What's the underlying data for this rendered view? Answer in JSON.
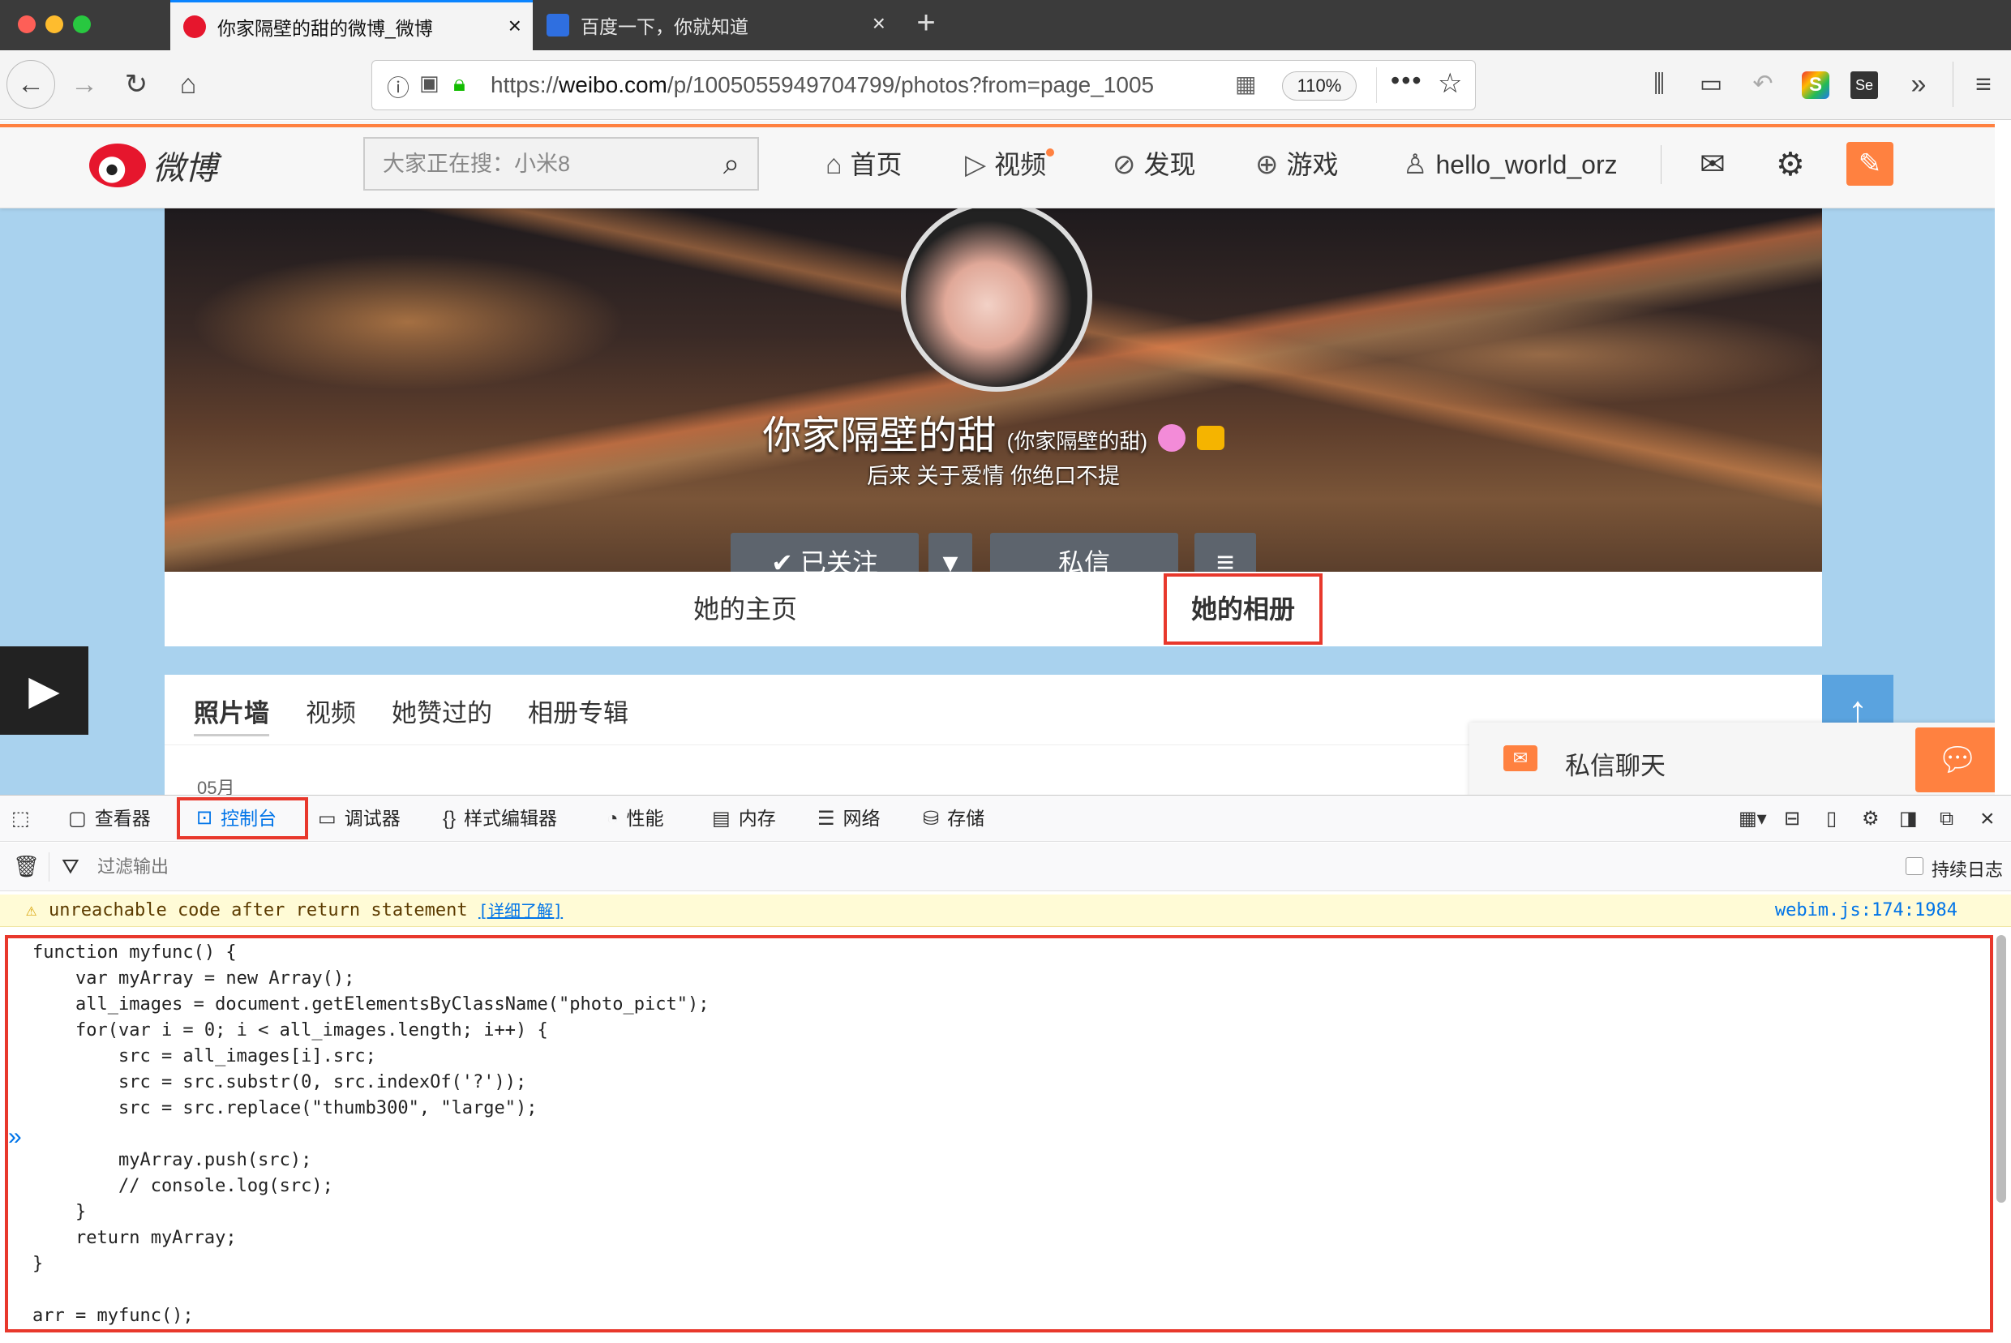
{
  "browser": {
    "tabs": [
      {
        "title": "你家隔壁的甜的微博_微博",
        "active": true
      },
      {
        "title": "百度一下，你就知道",
        "active": false
      }
    ],
    "url_prefix": "https://",
    "url_host": "weibo.com",
    "url_path": "/p/1005055949704799/photos?from=page_1005",
    "zoom": "110%"
  },
  "weibo": {
    "logo_text": "微博",
    "search_placeholder": "大家正在搜：小米8",
    "nav": {
      "home": "首页",
      "video": "视频",
      "discover": "发现",
      "games": "游戏",
      "user": "hello_world_orz"
    },
    "profile": {
      "name": "你家隔壁的甜",
      "nickname": "(你家隔壁的甜)",
      "bio": "后来 关于爱情 你绝口不提",
      "follow_label": "已关注",
      "message_label": "私信"
    },
    "profile_tabs": [
      "她的主页",
      "她的相册"
    ],
    "album_tabs": [
      "照片墙",
      "视频",
      "她赞过的",
      "相册专辑"
    ],
    "date_label": "05月",
    "chat_label": "私信聊天"
  },
  "devtools": {
    "tabs": [
      "查看器",
      "控制台",
      "调试器",
      "样式编辑器",
      "性能",
      "内存",
      "网络",
      "存储"
    ],
    "filter_placeholder": "过滤输出",
    "persist_label": "持续日志",
    "warning_text": "unreachable code after return statement",
    "warning_link": "[详细了解]",
    "warning_source": "webim.js:174:1984",
    "code": "function myfunc() {\n    var myArray = new Array();\n    all_images = document.getElementsByClassName(\"photo_pict\");\n    for(var i = 0; i < all_images.length; i++) {\n        src = all_images[i].src;\n        src = src.substr(0, src.indexOf('?'));\n        src = src.replace(\"thumb300\", \"large\");\n\n        myArray.push(src);\n        // console.log(src);\n    }\n    return myArray;\n}\n\narr = myfunc();"
  },
  "colors": {
    "highlight_red": "#e8382c",
    "weibo_orange": "#ff8140",
    "firefox_blue": "#0a84ff"
  }
}
